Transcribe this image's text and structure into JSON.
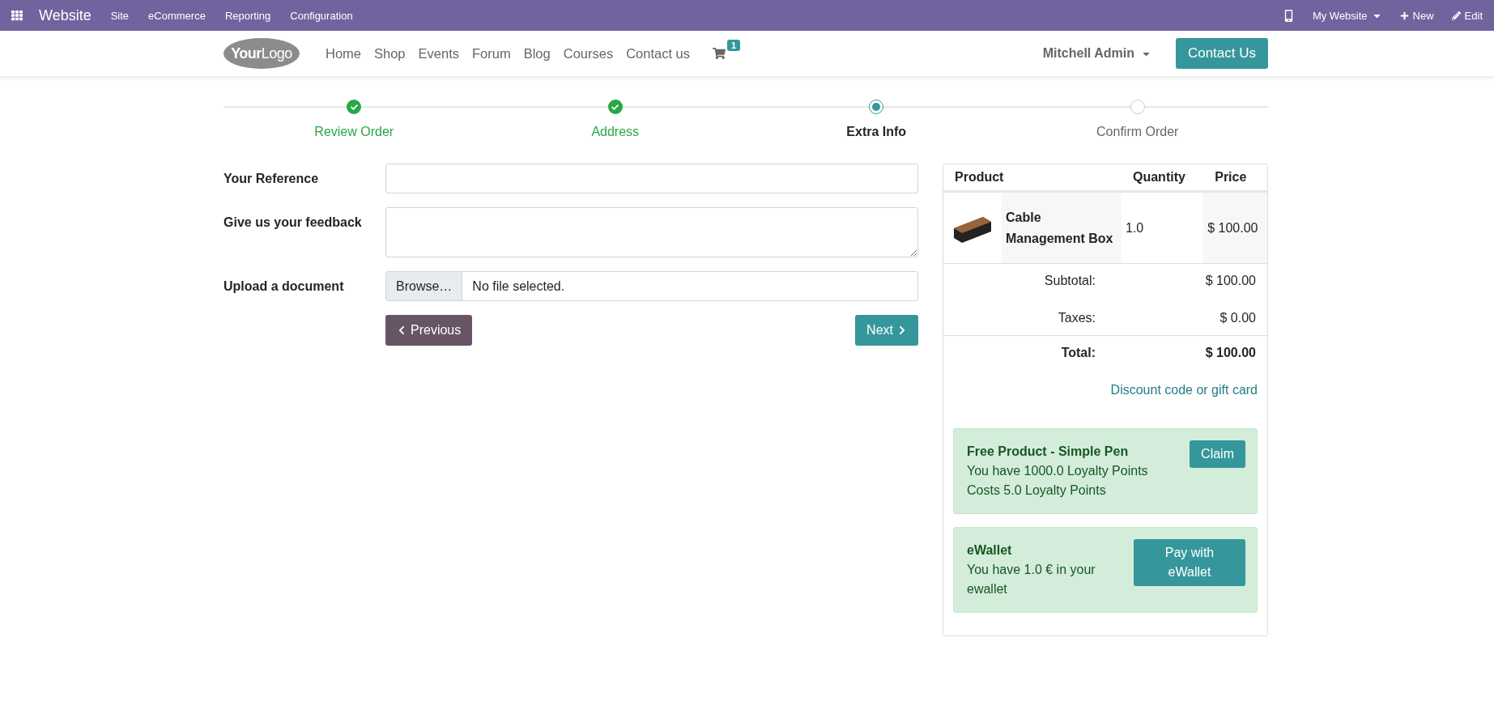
{
  "topbar": {
    "app": "Website",
    "menus": [
      "Site",
      "eCommerce",
      "Reporting",
      "Configuration"
    ],
    "website": "My Website",
    "new": "New",
    "edit": "Edit"
  },
  "header": {
    "logo": {
      "first": "Your",
      "second": "Logo"
    },
    "nav": [
      "Home",
      "Shop",
      "Events",
      "Forum",
      "Blog",
      "Courses",
      "Contact us"
    ],
    "cart_count": "1",
    "user": "Mitchell Admin",
    "cta": "Contact Us"
  },
  "steps": [
    {
      "label": "Review Order",
      "done": true,
      "selected": false
    },
    {
      "label": "Address",
      "done": true,
      "selected": false
    },
    {
      "label": "Extra Info",
      "done": false,
      "selected": true
    },
    {
      "label": "Confirm Order",
      "done": false,
      "selected": false
    }
  ],
  "form": {
    "fields": [
      {
        "label": "Your Reference",
        "kind": "text"
      },
      {
        "label": "Give us your feedback",
        "kind": "textarea"
      },
      {
        "label": "Upload a document",
        "kind": "file",
        "button": "Browse…",
        "value": "No file selected."
      }
    ],
    "previous": "Previous",
    "next": "Next"
  },
  "summary": {
    "columns": [
      "Product",
      "Quantity",
      "Price"
    ],
    "rows": [
      {
        "name": "Cable Management Box",
        "quantity": "1.0",
        "price": "$ 100.00"
      }
    ],
    "subtotal": {
      "label": "Subtotal:",
      "value": "$ 100.00"
    },
    "taxes": {
      "label": "Taxes:",
      "value": "$ 0.00"
    },
    "total": {
      "label": "Total:",
      "value": "$ 100.00"
    },
    "discount_link": "Discount code or gift card",
    "rewards": [
      {
        "title": "Free Product - Simple Pen",
        "lines": [
          "You have 1000.0 Loyalty Points",
          "Costs 5.0 Loyalty Points"
        ],
        "button": "Claim"
      },
      {
        "title": "eWallet",
        "lines": [
          "You have 1.0 € in your ewallet"
        ],
        "button": "Pay with eWallet"
      }
    ]
  }
}
